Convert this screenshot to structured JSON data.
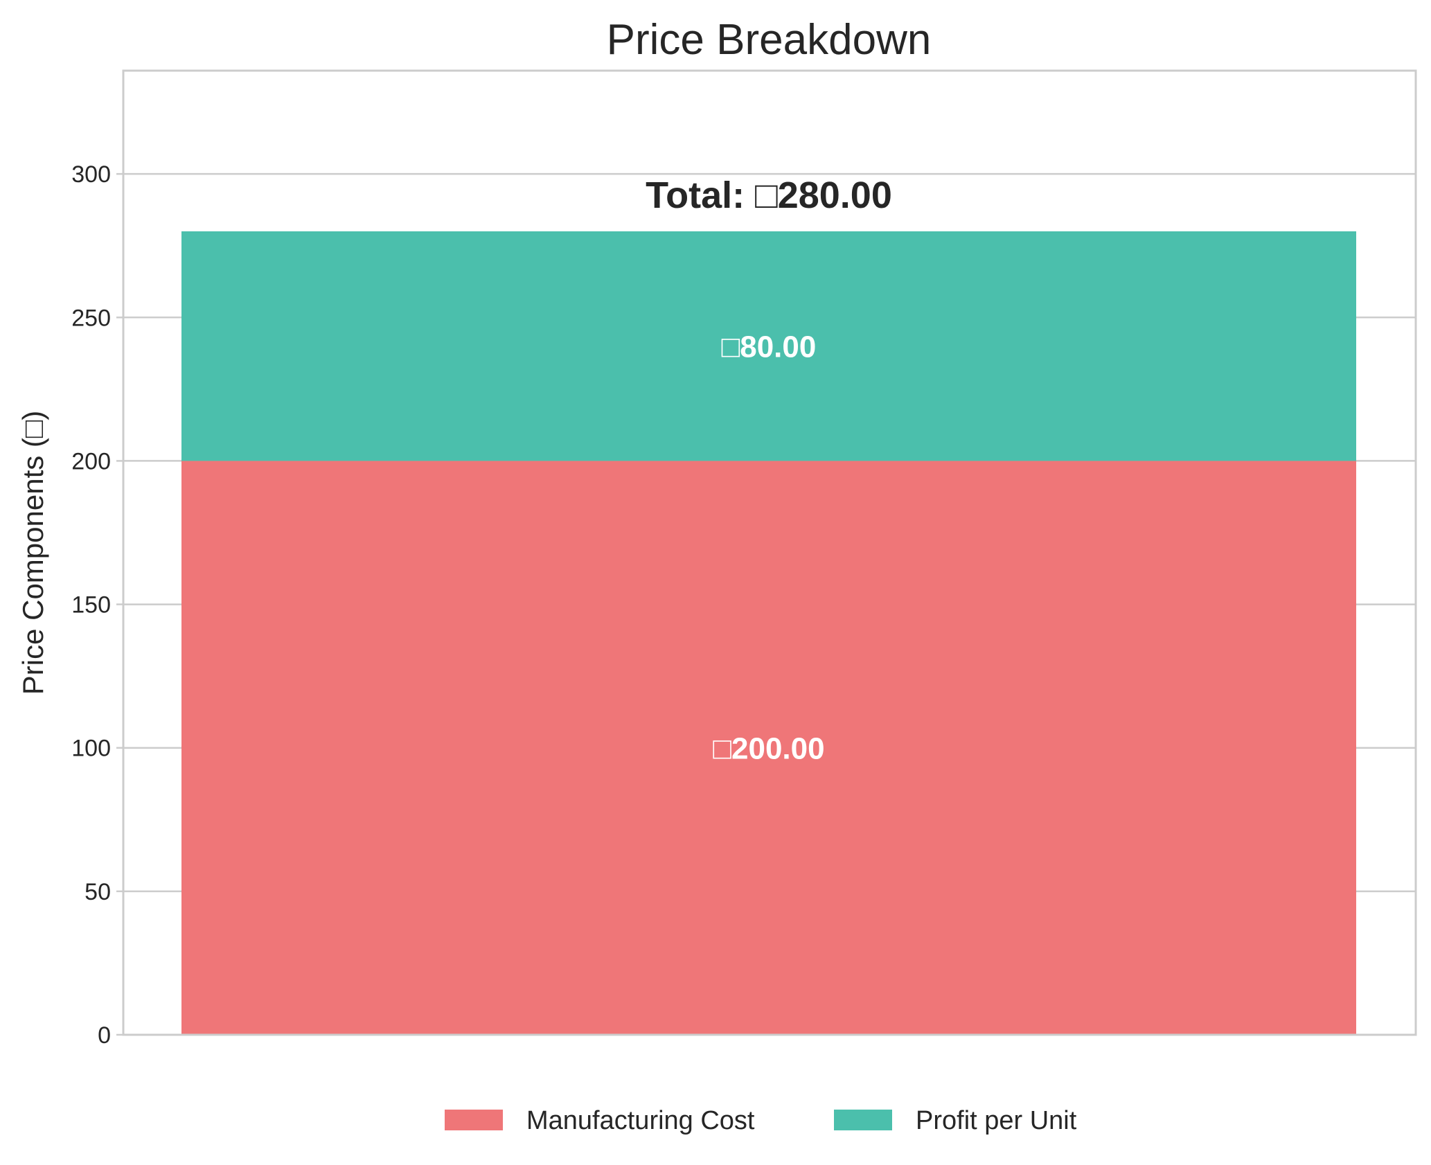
{
  "chart_data": {
    "type": "bar",
    "stacked": true,
    "title": "Price Breakdown",
    "xlabel": "",
    "ylabel": "Price Components (□)",
    "ylim": [
      0,
      336
    ],
    "yticks": [
      0,
      50,
      100,
      150,
      200,
      250,
      300
    ],
    "grid": true,
    "categories": [
      ""
    ],
    "series": [
      {
        "name": "Manufacturing Cost",
        "values": [
          200
        ],
        "color": "#ef7678",
        "label": "□200.00"
      },
      {
        "name": "Profit per Unit",
        "values": [
          80
        ],
        "color": "#4bbfac",
        "label": "□80.00"
      }
    ],
    "total_label": "Total: □280.00",
    "legend_position": "bottom-center"
  }
}
